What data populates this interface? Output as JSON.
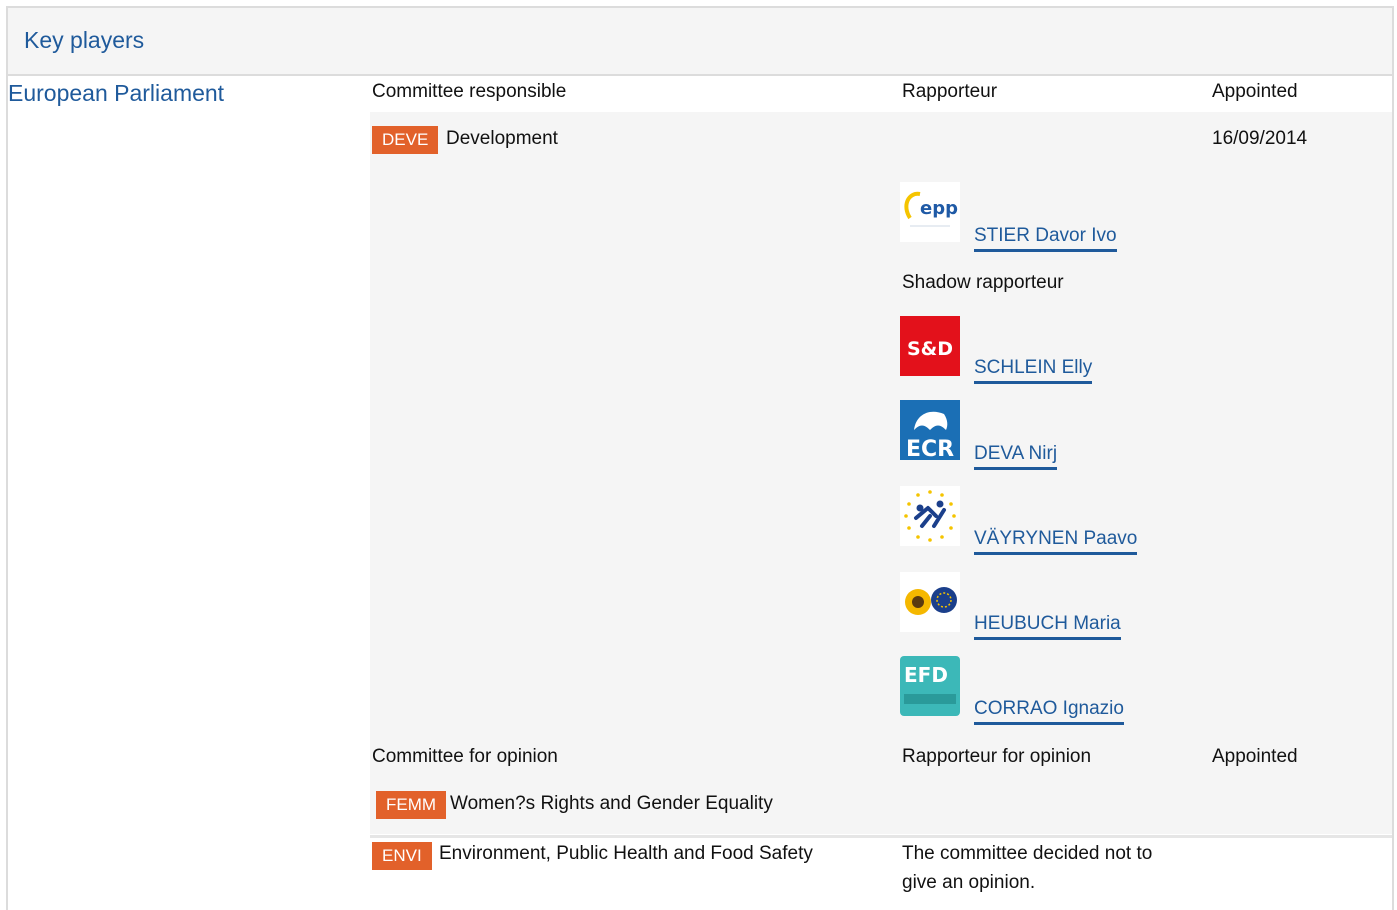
{
  "header": {
    "title": "Key players"
  },
  "institution": "European Parliament",
  "responsible": {
    "label": "Committee responsible",
    "rapporteur_label": "Rapporteur",
    "appointed_label": "Appointed",
    "committee": {
      "code": "DEVE",
      "name": "Development",
      "appointed": "16/09/2014"
    },
    "rapporteur": {
      "name": "STIER Davor Ivo",
      "group_icon": "epp-logo-icon",
      "logo_text": "epp"
    },
    "shadow_label": "Shadow rapporteur",
    "shadows": [
      {
        "name": "SCHLEIN Elly",
        "group_icon": "sd-logo-icon",
        "logo_text": "S&D"
      },
      {
        "name": "DEVA Nirj",
        "group_icon": "ecr-logo-icon",
        "logo_text": "ECR"
      },
      {
        "name": "VÄYRYNEN Paavo",
        "group_icon": "alde-logo-icon"
      },
      {
        "name": "HEUBUCH Maria",
        "group_icon": "greens-efa-logo-icon"
      },
      {
        "name": "CORRAO Ignazio",
        "group_icon": "efdd-logo-icon",
        "logo_text": "EFD"
      }
    ]
  },
  "opinion": {
    "label": "Committee for opinion",
    "rapporteur_label": "Rapporteur for opinion",
    "appointed_label": "Appointed",
    "committees": [
      {
        "code": "FEMM",
        "name": "Women?s Rights and Gender Equality",
        "note": ""
      },
      {
        "code": "ENVI",
        "name": "Environment, Public Health and Food Safety",
        "note_line1": "The committee decided not to",
        "note_line2": "give an opinion."
      }
    ]
  },
  "colors": {
    "link": "#1f5a9b",
    "badge": "#e2612a",
    "panel": "#f5f5f5"
  }
}
